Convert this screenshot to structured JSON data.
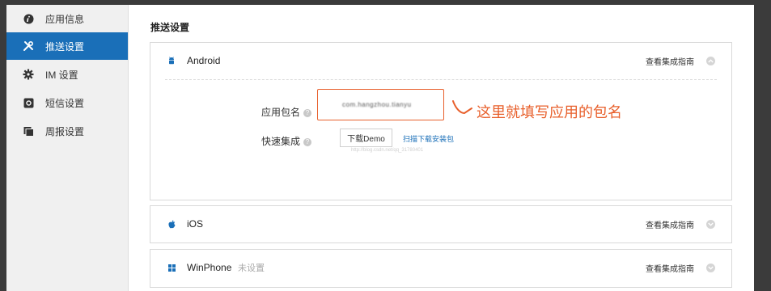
{
  "sidebar": {
    "items": [
      {
        "label": "应用信息",
        "icon": "info-icon",
        "active": false
      },
      {
        "label": "推送设置",
        "icon": "tools-icon",
        "active": true
      },
      {
        "label": "IM 设置",
        "icon": "gear-icon",
        "active": false
      },
      {
        "label": "短信设置",
        "icon": "sms-icon",
        "active": false
      },
      {
        "label": "周报设置",
        "icon": "report-icon",
        "active": false
      }
    ]
  },
  "main": {
    "title": "推送设置",
    "guide_label": "查看集成指南",
    "android": {
      "name": "Android",
      "icon": "android-icon",
      "package_label": "应用包名",
      "package_value": "com.hangzhou.tianyu",
      "quick_label": "快速集成",
      "demo_button": "下载Demo",
      "scan_link": "扫描下载安装包",
      "watermark": "http://blog.csdn.net/qq_31780401",
      "annotation": "这里就填写应用的包名",
      "help_glyph": "?"
    },
    "ios": {
      "name": "iOS",
      "icon": "apple-icon"
    },
    "winphone": {
      "name": "WinPhone",
      "icon": "windows-icon",
      "status": "未设置"
    }
  },
  "colors": {
    "accent": "#1a6fb8",
    "annotation": "#e8602c",
    "frame": "#3b3b3b"
  }
}
